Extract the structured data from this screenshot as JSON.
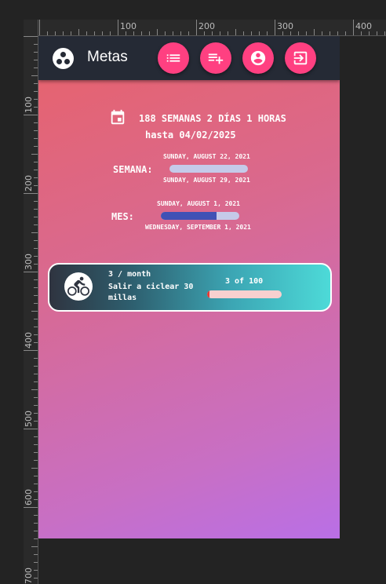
{
  "ruler": {
    "top_labels": [
      "100",
      "200",
      "300",
      "400"
    ],
    "left_labels": [
      "100",
      "200",
      "300",
      "400",
      "500",
      "600",
      "700"
    ]
  },
  "appbar": {
    "title": "Metas",
    "actions": [
      {
        "name": "list-icon"
      },
      {
        "name": "playlist-add-icon"
      },
      {
        "name": "account-icon"
      },
      {
        "name": "logout-icon"
      }
    ]
  },
  "countdown": {
    "remaining": "188 SEMANAS 2 DÍAS 1 HORAS",
    "until": "hasta 04/02/2025"
  },
  "week": {
    "label": "SEMANA:",
    "start": "SUNDAY, AUGUST 22, 2021",
    "end": "SUNDAY, AUGUST 29, 2021",
    "progress": 0.0
  },
  "month": {
    "label": "MES:",
    "start": "SUNDAY, AUGUST 1, 2021",
    "end": "WEDNESDAY, SEPTEMBER 1, 2021",
    "progress": 0.71
  },
  "goal": {
    "icon": "bike-icon",
    "frequency": "3 / month",
    "name": "Salir a ciclear 30 millas",
    "count": "3 of 100",
    "progress": 0.03
  },
  "colors": {
    "accent": "#ff4081",
    "appbar": "#252a35",
    "bar_track": "#c5cae9",
    "bar_fill": "#3f51b5"
  }
}
